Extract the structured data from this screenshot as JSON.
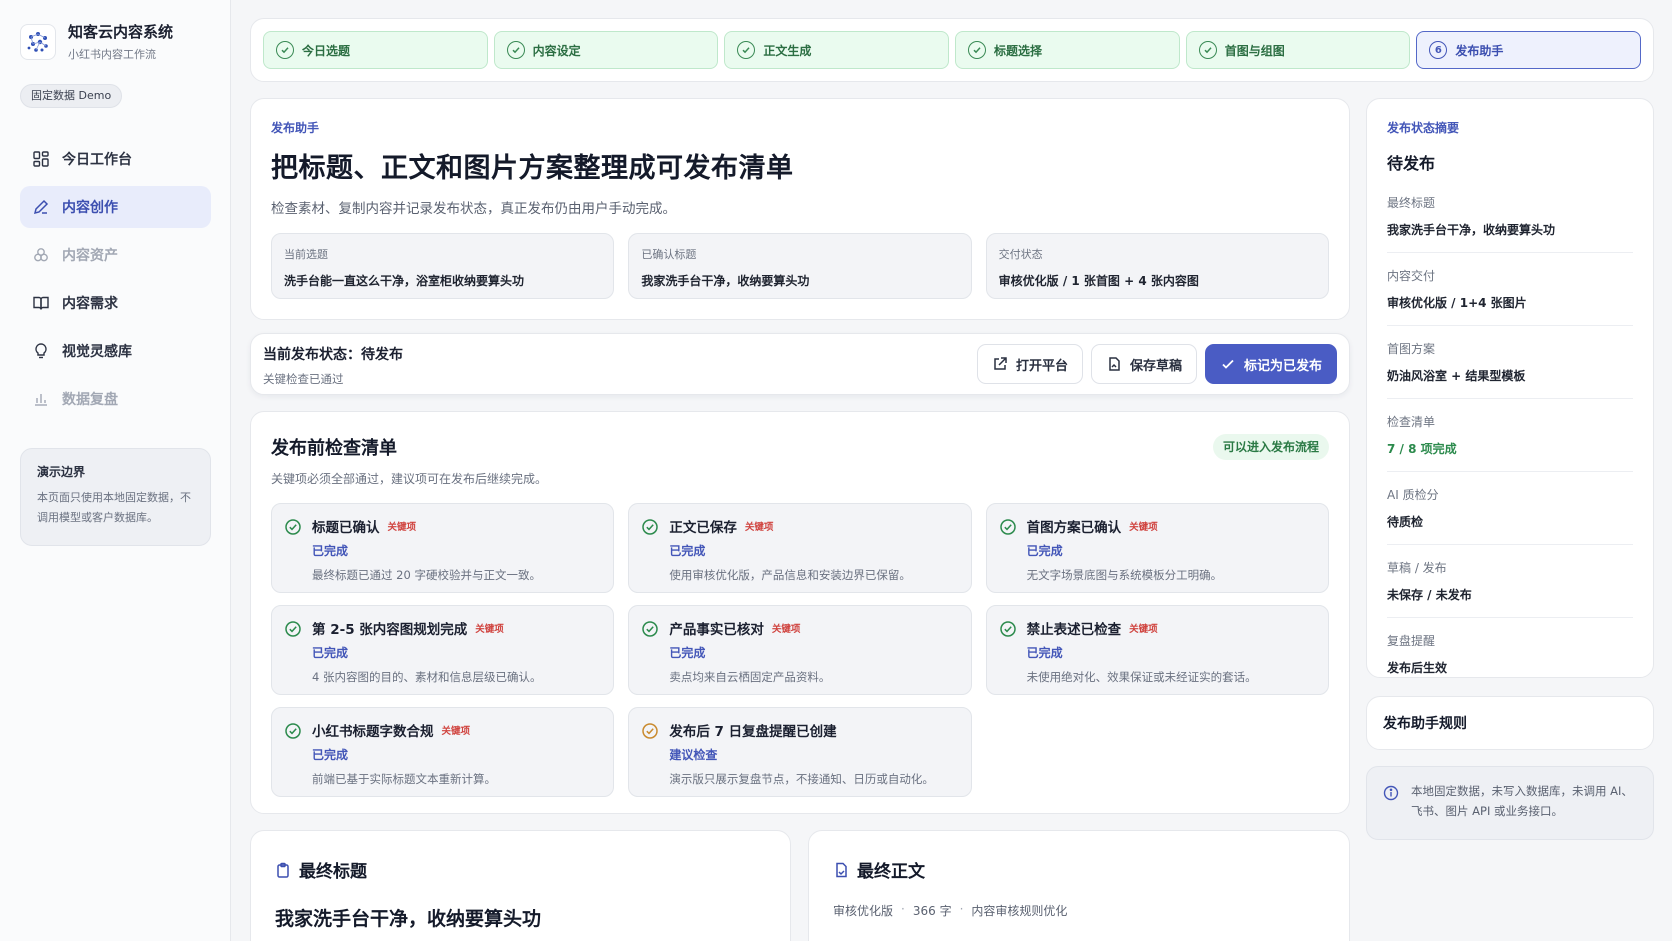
{
  "brand": {
    "title": "知客云内容系统",
    "subtitle": "小红书内容工作流",
    "badge": "固定数据 Demo"
  },
  "nav": [
    {
      "label": "今日工作台",
      "icon": "grid-icon",
      "state": "normal"
    },
    {
      "label": "内容创作",
      "icon": "pen-icon",
      "state": "active"
    },
    {
      "label": "内容资产",
      "icon": "layers-icon",
      "state": "muted"
    },
    {
      "label": "内容需求",
      "icon": "book-icon",
      "state": "normal"
    },
    {
      "label": "视觉灵感库",
      "icon": "lightbulb-icon",
      "state": "normal"
    },
    {
      "label": "数据复盘",
      "icon": "bar-chart-icon",
      "state": "muted"
    }
  ],
  "demo_box": {
    "title": "演示边界",
    "text": "本页面只使用本地固定数据，不调用模型或客户数据库。"
  },
  "steps": [
    {
      "label": "今日选题",
      "state": "done"
    },
    {
      "label": "内容设定",
      "state": "done"
    },
    {
      "label": "正文生成",
      "state": "done"
    },
    {
      "label": "标题选择",
      "state": "done"
    },
    {
      "label": "首图与组图",
      "state": "done"
    },
    {
      "label": "发布助手",
      "state": "current",
      "num": "6"
    }
  ],
  "header": {
    "eyebrow": "发布助手",
    "title": "把标题、正文和图片方案整理成可发布清单",
    "desc": "检查素材、复制内容并记录发布状态，真正发布仍由用户手动完成。",
    "info": [
      {
        "label": "当前选题",
        "value": "洗手台能一直这么干净，浴室柜收纳要算头功"
      },
      {
        "label": "已确认标题",
        "value": "我家洗手台干净，收纳要算头功"
      },
      {
        "label": "交付状态",
        "value": "审核优化版 / 1 张首图 + 4 张内容图"
      }
    ]
  },
  "status_bar": {
    "title": "当前发布状态：待发布",
    "sub": "关键检查已通过",
    "open_label": "打开平台",
    "draft_label": "保存草稿",
    "publish_label": "标记为已发布"
  },
  "checklist": {
    "title": "发布前检查清单",
    "desc": "关键项必须全部通过，建议项可在发布后继续完成。",
    "badge": "可以进入发布流程",
    "key_tag": "关键项",
    "items": [
      {
        "name": "标题已确认",
        "key": true,
        "state": "已完成",
        "note": "最终标题已通过 20 字硬校验并与正文一致。",
        "status": "done"
      },
      {
        "name": "正文已保存",
        "key": true,
        "state": "已完成",
        "note": "使用审核优化版，产品信息和安装边界已保留。",
        "status": "done"
      },
      {
        "name": "首图方案已确认",
        "key": true,
        "state": "已完成",
        "note": "无文字场景底图与系统模板分工明确。",
        "status": "done"
      },
      {
        "name": "第 2-5 张内容图规划完成",
        "key": true,
        "state": "已完成",
        "note": "4 张内容图的目的、素材和信息层级已确认。",
        "status": "done"
      },
      {
        "name": "产品事实已核对",
        "key": true,
        "state": "已完成",
        "note": "卖点均来自云栖固定产品资料。",
        "status": "done"
      },
      {
        "name": "禁止表述已检查",
        "key": true,
        "state": "已完成",
        "note": "未使用绝对化、效果保证或未经证实的套话。",
        "status": "done"
      },
      {
        "name": "小红书标题字数合规",
        "key": true,
        "state": "已完成",
        "note": "前端已基于实际标题文本重新计算。",
        "status": "done"
      },
      {
        "name": "发布后 7 日复盘提醒已创建",
        "key": false,
        "state": "建议检查",
        "note": "演示版只展示复盘节点，不接通知、日历或自动化。",
        "status": "suggest"
      }
    ]
  },
  "final_title": {
    "heading": "最终标题",
    "value": "我家洗手台干净，收纳要算头功"
  },
  "final_body": {
    "heading": "最终正文",
    "meta": [
      "审核优化版",
      "366 字",
      "内容审核规则优化"
    ]
  },
  "summary": {
    "eyebrow": "发布状态摘要",
    "status": "待发布",
    "rows": [
      {
        "label": "最终标题",
        "value": "我家洗手台干净，收纳要算头功"
      },
      {
        "label": "内容交付",
        "value": "审核优化版 / 1+4 张图片"
      },
      {
        "label": "首图方案",
        "value": "奶油风浴室 + 结果型模板"
      },
      {
        "label": "检查清单",
        "value": "7 / 8 项完成",
        "green": true
      },
      {
        "label": "AI 质检分",
        "value": "待质检"
      },
      {
        "label": "草稿 / 发布",
        "value": "未保存 / 未发布"
      },
      {
        "label": "复盘提醒",
        "value": "发布后生效"
      }
    ]
  },
  "rules": {
    "title": "发布助手规则"
  },
  "notice": {
    "text": "本地固定数据，未写入数据库，未调用 AI、飞书、图片 API 或业务接口。"
  },
  "colors": {
    "accent": "#4a5cc4",
    "success": "#2b8a4c",
    "danger": "#d0433f"
  }
}
